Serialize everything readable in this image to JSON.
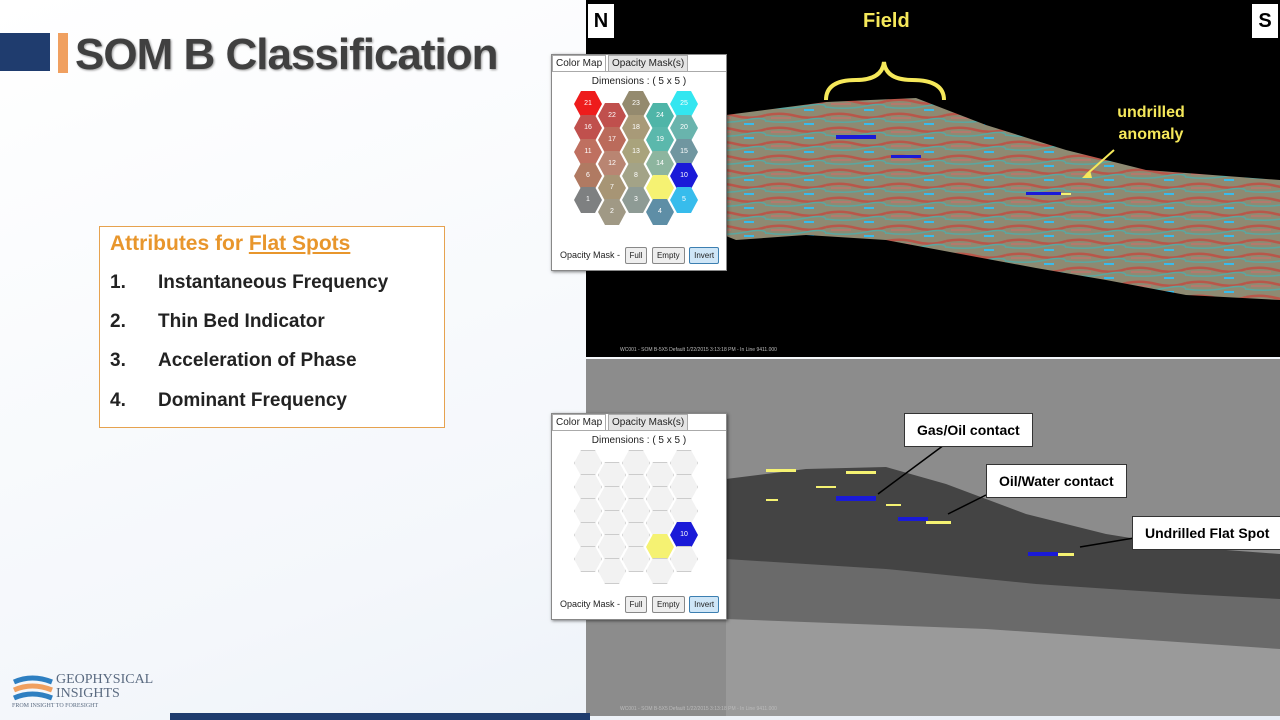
{
  "slide": {
    "title": "SOM B Classification"
  },
  "attributes": {
    "heading_prefix": "Attributes for ",
    "heading_highlight": "Flat Spots",
    "items": [
      {
        "num": "1.",
        "label": "Instantaneous Frequency"
      },
      {
        "num": "2.",
        "label": "Thin Bed Indicator"
      },
      {
        "num": "3.",
        "label": "Acceleration of Phase"
      },
      {
        "num": "4.",
        "label": "Dominant Frequency"
      }
    ]
  },
  "top_panel": {
    "north": "N",
    "south": "S",
    "field_label": "Field",
    "anomaly_label": "undrilled anomaly",
    "caption": "WC001 - SOM B-5X5 Default 1/22/2015 3:13:18 PM - In Line 9411.000"
  },
  "bottom_panel": {
    "callouts": [
      "Gas/Oil contact",
      "Oil/Water contact",
      "Undrilled Flat Spot"
    ],
    "caption": "WC001 - SOM B-5X5 Default 1/22/2015 3:13:18 PM - In Line 9411.000"
  },
  "color_map_widget": {
    "tab_color_map": "Color Map",
    "tab_opacity_mask": "Opacity Mask(s)",
    "dimensions": "Dimensions :  ( 5 x 5 )",
    "opacity_mask_label": "Opacity Mask -",
    "btn_full": "Full",
    "btn_empty": "Empty",
    "btn_invert": "Invert",
    "cells": [
      {
        "n": "21",
        "color": "#ee1c1c"
      },
      {
        "n": "22",
        "color": "#c0504d"
      },
      {
        "n": "23",
        "color": "#948a6e"
      },
      {
        "n": "24",
        "color": "#4fb5a8"
      },
      {
        "n": "25",
        "color": "#33e6f0"
      },
      {
        "n": "16",
        "color": "#c0504d"
      },
      {
        "n": "17",
        "color": "#bb6b5b"
      },
      {
        "n": "18",
        "color": "#a89a78"
      },
      {
        "n": "19",
        "color": "#5bb8ac"
      },
      {
        "n": "20",
        "color": "#69b4ad"
      },
      {
        "n": "11",
        "color": "#bf7060"
      },
      {
        "n": "12",
        "color": "#b98572"
      },
      {
        "n": "13",
        "color": "#a9a37c"
      },
      {
        "n": "14",
        "color": "#8db59f"
      },
      {
        "n": "15",
        "color": "#7096a0"
      },
      {
        "n": "6",
        "color": "#b07a62"
      },
      {
        "n": "7",
        "color": "#a79575"
      },
      {
        "n": "8",
        "color": "#a3a387"
      },
      {
        "n": "9",
        "color": "#f5f272"
      },
      {
        "n": "10",
        "color": "#1a1ad8"
      },
      {
        "n": "1",
        "color": "#7e8081"
      },
      {
        "n": "2",
        "color": "#a09985"
      },
      {
        "n": "3",
        "color": "#8e9b95"
      },
      {
        "n": "4",
        "color": "#5e8ea6"
      },
      {
        "n": "5",
        "color": "#37bcec"
      }
    ],
    "visible_in_mask": [
      "9",
      "10"
    ]
  },
  "logo": {
    "line1": "GEOPHYSICAL",
    "line2": "INSIGHTS",
    "tagline": "FROM INSIGHT TO FORESIGHT"
  },
  "colors": {
    "accent_orange": "#e8962c",
    "navy": "#1f3c6e",
    "annotation_yellow": "#f5e85a"
  }
}
